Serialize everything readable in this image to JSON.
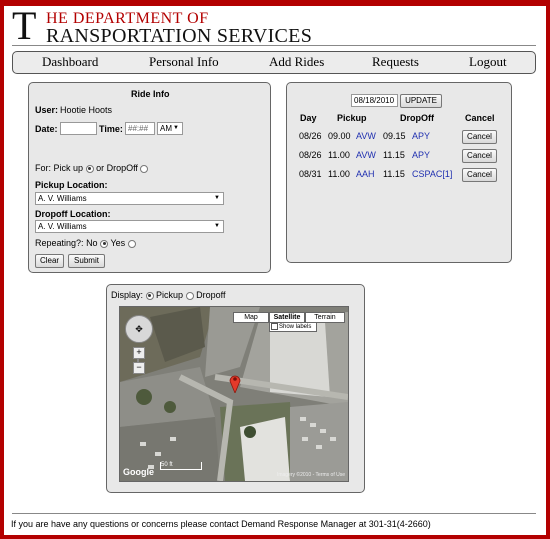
{
  "header": {
    "logo_big_letter": "T",
    "logo_line1": "HE DEPARTMENT OF",
    "logo_line2": "RANSPORTATION SERVICES"
  },
  "nav": {
    "items": [
      {
        "label": "Dashboard"
      },
      {
        "label": "Personal Info"
      },
      {
        "label": "Add Rides"
      },
      {
        "label": "Requests"
      },
      {
        "label": "Logout"
      }
    ]
  },
  "ride_info": {
    "title": "Ride Info",
    "user_label": "User:",
    "user_value": "Hootie Hoots",
    "date_label": "Date:",
    "time_label": "Time:",
    "time_placeholder": "##:##",
    "ampm_value": "AM",
    "for_label": "For:",
    "pickup_option": "Pick up",
    "dropoff_option": "or DropOff",
    "pickup_location_label": "Pickup Location:",
    "pickup_location_value": "A. V. Williams",
    "dropoff_location_label": "Dropoff Location:",
    "dropoff_location_value": "A. V. Williams",
    "repeating_label": "Repeating?:",
    "repeating_no": "No",
    "repeating_yes": "Yes",
    "clear_label": "Clear",
    "submit_label": "Submit"
  },
  "requests": {
    "date_value": "08/18/2010",
    "update_label": "UPDATE",
    "columns": [
      "Day",
      "Pickup",
      "DropOff",
      "Cancel"
    ],
    "rows": [
      {
        "day": "08/26",
        "pickup_time": "09.00",
        "pickup_loc": "AVW",
        "dropoff_time": "09.15",
        "dropoff_loc": "APY",
        "cancel_label": "Cancel"
      },
      {
        "day": "08/26",
        "pickup_time": "11.00",
        "pickup_loc": "AVW",
        "dropoff_time": "11.15",
        "dropoff_loc": "APY",
        "cancel_label": "Cancel"
      },
      {
        "day": "08/31",
        "pickup_time": "11.00",
        "pickup_loc": "AAH",
        "dropoff_time": "11.15",
        "dropoff_loc": "CSPAC[1]",
        "cancel_label": "Cancel"
      }
    ]
  },
  "map_panel": {
    "display_label": "Display:",
    "pickup_option": "Pickup",
    "dropoff_option": "Dropoff",
    "map_types": [
      "Map",
      "Satellite",
      "Terrain"
    ],
    "show_labels": "Show labels",
    "scale_label": "50 ft",
    "google_label": "Google",
    "copyright": "Imagery ©2010 - Terms of Use"
  },
  "footer": {
    "text": "If you are have any questions or concerns please contact Demand Response Manager at 301-31(4-2660)"
  },
  "colors": {
    "brand_red": "#b30000",
    "panel_bg": "#e8e8e8",
    "link_blue": "#2030b0"
  }
}
